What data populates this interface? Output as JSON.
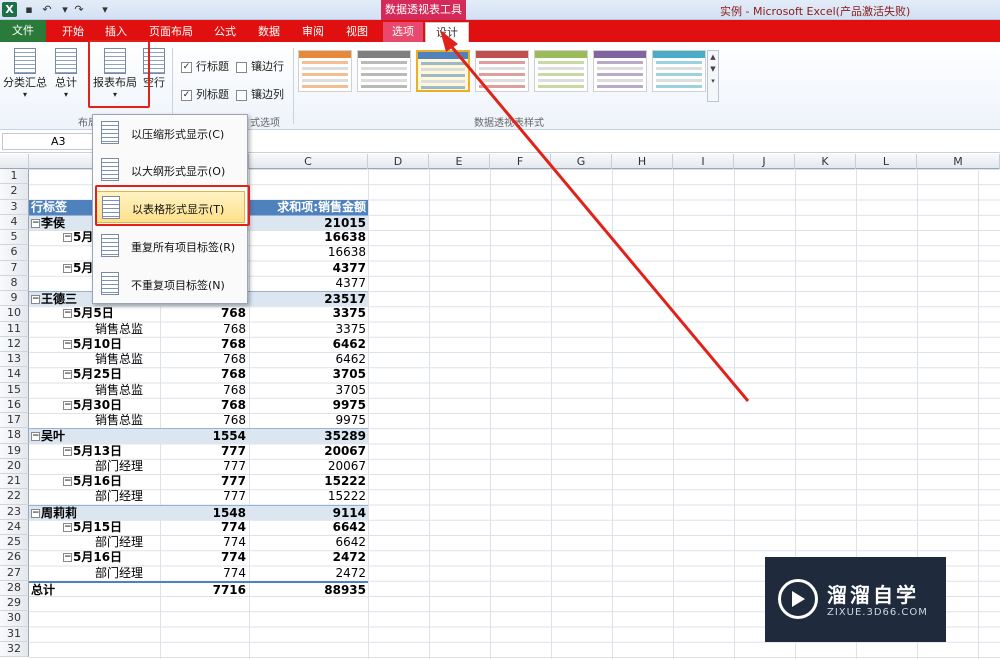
{
  "window": {
    "app_icon": "X",
    "tool_context": "数据透视表工具",
    "title": "实例 - Microsoft Excel(产品激活失败)"
  },
  "tabs": [
    "文件",
    "开始",
    "插入",
    "页面布局",
    "公式",
    "数据",
    "审阅",
    "视图",
    "选项",
    "设计"
  ],
  "ribbon": {
    "subtotals": "分类汇总",
    "grand_totals": "总计",
    "report_layout": "报表布局",
    "blank_rows": "空行",
    "layout_group": "布局",
    "row_headers": "行标题",
    "banded_rows": "镶边行",
    "col_headers": "列标题",
    "banded_cols": "镶边列",
    "style_options_group": "式选项",
    "styles_group": "数据透视表样式",
    "row_headers_checked": true,
    "col_headers_checked": true,
    "banded_rows_checked": false,
    "banded_cols_checked": false
  },
  "style_colors": [
    "#e8893a",
    "#7f7f7f",
    "#4f81bd",
    "#c0504d",
    "#9bbb59",
    "#8064a2",
    "#4bacc6"
  ],
  "namebox": "A3",
  "columns": [
    "C",
    "D",
    "E",
    "F",
    "G",
    "H",
    "I",
    "J",
    "K",
    "L",
    "M"
  ],
  "rows_numbers": [
    "1",
    "2",
    "3",
    "4",
    "5",
    "6",
    "7",
    "8",
    "9",
    "10",
    "11",
    "12",
    "13",
    "14",
    "15",
    "16",
    "17",
    "18",
    "19",
    "20",
    "21",
    "22",
    "23",
    "24",
    "25",
    "26",
    "27",
    "28",
    "29",
    "30",
    "31",
    "32"
  ],
  "pivot": {
    "header_a": "行标签",
    "header_c": "求和项:销售金额",
    "rows": [
      {
        "r": 4,
        "a": "⊟李侯",
        "b": "",
        "c": "21015",
        "kind": "grp"
      },
      {
        "r": 5,
        "a": "⊟5月",
        "b": "",
        "c": "16638",
        "kind": "sub",
        "indent": 1
      },
      {
        "r": 6,
        "a": "",
        "b": "",
        "c": "16638",
        "kind": "det"
      },
      {
        "r": 7,
        "a": "⊟5月",
        "b": "",
        "c": "4377",
        "kind": "sub",
        "indent": 1
      },
      {
        "r": 8,
        "a": "",
        "b": "",
        "c": "4377",
        "kind": "det"
      },
      {
        "r": 9,
        "a": "⊟王德三",
        "b": "",
        "c": "23517",
        "kind": "grp"
      },
      {
        "r": 10,
        "a": "⊟5月5日",
        "b": "768",
        "c": "3375",
        "kind": "sub",
        "indent": 1
      },
      {
        "r": 11,
        "a": "销售总监",
        "b": "768",
        "c": "3375",
        "kind": "det",
        "indent": 2
      },
      {
        "r": 12,
        "a": "⊟5月10日",
        "b": "768",
        "c": "6462",
        "kind": "sub",
        "indent": 1
      },
      {
        "r": 13,
        "a": "销售总监",
        "b": "768",
        "c": "6462",
        "kind": "det",
        "indent": 2
      },
      {
        "r": 14,
        "a": "⊟5月25日",
        "b": "768",
        "c": "3705",
        "kind": "sub",
        "indent": 1
      },
      {
        "r": 15,
        "a": "销售总监",
        "b": "768",
        "c": "3705",
        "kind": "det",
        "indent": 2
      },
      {
        "r": 16,
        "a": "⊟5月30日",
        "b": "768",
        "c": "9975",
        "kind": "sub",
        "indent": 1
      },
      {
        "r": 17,
        "a": "销售总监",
        "b": "768",
        "c": "9975",
        "kind": "det",
        "indent": 2
      },
      {
        "r": 18,
        "a": "⊟吴叶",
        "b": "1554",
        "c": "35289",
        "kind": "grp"
      },
      {
        "r": 19,
        "a": "⊟5月13日",
        "b": "777",
        "c": "20067",
        "kind": "sub",
        "indent": 1
      },
      {
        "r": 20,
        "a": "部门经理",
        "b": "777",
        "c": "20067",
        "kind": "det",
        "indent": 2
      },
      {
        "r": 21,
        "a": "⊟5月16日",
        "b": "777",
        "c": "15222",
        "kind": "sub",
        "indent": 1
      },
      {
        "r": 22,
        "a": "部门经理",
        "b": "777",
        "c": "15222",
        "kind": "det",
        "indent": 2
      },
      {
        "r": 23,
        "a": "⊟周莉莉",
        "b": "1548",
        "c": "9114",
        "kind": "grp"
      },
      {
        "r": 24,
        "a": "⊟5月15日",
        "b": "774",
        "c": "6642",
        "kind": "sub",
        "indent": 1
      },
      {
        "r": 25,
        "a": "部门经理",
        "b": "774",
        "c": "6642",
        "kind": "det",
        "indent": 2
      },
      {
        "r": 26,
        "a": "⊟5月16日",
        "b": "774",
        "c": "2472",
        "kind": "sub",
        "indent": 1
      },
      {
        "r": 27,
        "a": "部门经理",
        "b": "774",
        "c": "2472",
        "kind": "det",
        "indent": 2
      },
      {
        "r": 28,
        "a": "总计",
        "b": "7716",
        "c": "88935",
        "kind": "tot"
      }
    ]
  },
  "dropdown": {
    "items": [
      "以压缩形式显示(C)",
      "以大纲形式显示(O)",
      "以表格形式显示(T)",
      "重复所有项目标签(R)",
      "不重复项目标签(N)"
    ]
  },
  "watermark": {
    "name": "溜溜自学",
    "url": "ZIXUE.3D66.COM"
  }
}
